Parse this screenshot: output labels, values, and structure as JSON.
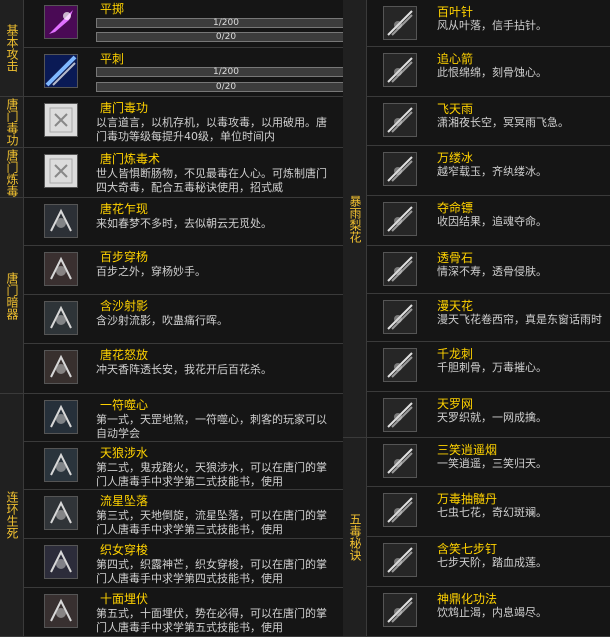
{
  "left": {
    "categories": [
      {
        "label": "基本攻击"
      },
      {
        "label": "唐门毒功"
      },
      {
        "label": "唐门炼毒"
      },
      {
        "label": "唐门暗器"
      },
      {
        "label": "连环生死"
      }
    ],
    "basic_skills": [
      {
        "name": "平掷",
        "progress1": "1/200",
        "progress1_value": 0.005,
        "progress2": "0/20",
        "progress2_value": 0,
        "icon": "purple-slash-icon"
      },
      {
        "name": "平刺",
        "progress1": "1/200",
        "progress1_value": 0.005,
        "progress2": "0/20",
        "progress2_value": 0,
        "icon": "blue-thrust-icon"
      }
    ],
    "skills": [
      {
        "name": "唐门毒功",
        "desc": "以言道言，以机存机，以毒攻毒，以用破用。唐门毒功等级每提升40级，单位时间内",
        "icon": "scroll-icon"
      },
      {
        "name": "唐门炼毒术",
        "desc": "世人皆惧断肠物，不见最毒在人心。可炼制唐门四大奇毒，配合五毒秘诀使用，招式威",
        "icon": "scroll-icon"
      },
      {
        "name": "唐花乍现",
        "desc": "来如春梦不多时，去似朝云无觅处。",
        "icon": "flower-icon"
      },
      {
        "name": "百步穿杨",
        "desc": "百步之外，穿杨妙手。",
        "icon": "arrow-icon"
      },
      {
        "name": "含沙射影",
        "desc": "含沙射流影，吹蛊痛行晖。",
        "icon": "claw-icon"
      },
      {
        "name": "唐花怒放",
        "desc": "冲天香阵透长安，我花开后百花杀。",
        "icon": "burst-icon"
      },
      {
        "name": "一符噬心",
        "desc": "第一式，天罡地煞，一符噬心，刺客的玩家可以自动学会",
        "icon": "swirl-icon"
      },
      {
        "name": "天狼涉水",
        "desc": "第二式，鬼戎踏火，天狼涉水，可以在唐门的掌门人唐毒手中求学第二式技能书，使用",
        "icon": "wolf-icon"
      },
      {
        "name": "流星坠落",
        "desc": "第三式，天地倒旋，流星坠落，可以在唐门的掌门人唐毒手中求学第三式技能书，使用",
        "icon": "meteor-icon"
      },
      {
        "name": "织女穿梭",
        "desc": "第四式，织露神芒，织女穿梭，可以在唐门的掌门人唐毒手中求学第四式技能书，使用",
        "icon": "weave-icon"
      },
      {
        "name": "十面埋伏",
        "desc": "第五式，十面埋伏，势在必得，可以在唐门的掌门人唐毒手中求学第五式技能书，使用",
        "icon": "ambush-icon"
      }
    ]
  },
  "right": {
    "categories": [
      {
        "label": "暴雨梨花"
      },
      {
        "label": "五毒秘诀"
      }
    ],
    "skills": [
      {
        "name": "百叶针",
        "desc": "风从叶落，信手拈针。",
        "icon": "needle-icon"
      },
      {
        "name": "追心箭",
        "desc": "此恨绵绵，刻骨蚀心。",
        "icon": "heart-arrow-icon"
      },
      {
        "name": "飞天雨",
        "desc": "潇湘夜长空，冥冥雨飞急。",
        "icon": "rain-icon"
      },
      {
        "name": "万缕冰",
        "desc": "越窄载玉，齐纨缕冰。",
        "icon": "ice-icon"
      },
      {
        "name": "夺命镖",
        "desc": "收因结果，追魂夺命。",
        "icon": "dart-icon"
      },
      {
        "name": "透骨石",
        "desc": "情深不寿，透骨侵肤。",
        "icon": "stone-icon"
      },
      {
        "name": "漫天花",
        "desc": "漫天飞花卷西帘，真是东窗话雨时",
        "icon": "petals-icon"
      },
      {
        "name": "千龙刺",
        "desc": "千胆刺骨，万毒摧心。",
        "icon": "dragon-icon"
      },
      {
        "name": "天罗网",
        "desc": "天罗织就，一网成擒。",
        "icon": "net-icon"
      },
      {
        "name": "三笑逍遥烟",
        "desc": "一笑逍遥，三笑归天。",
        "icon": "smoke-icon"
      },
      {
        "name": "万毒抽髓丹",
        "desc": "七虫七花，奇幻斑斓。",
        "icon": "pill-icon"
      },
      {
        "name": "含笑七步钉",
        "desc": "七步天阶，踏血成莲。",
        "icon": "nail-icon"
      },
      {
        "name": "神鼎化功法",
        "desc": "饮鸩止渴，内息竭尽。",
        "icon": "cauldron-icon"
      }
    ]
  }
}
